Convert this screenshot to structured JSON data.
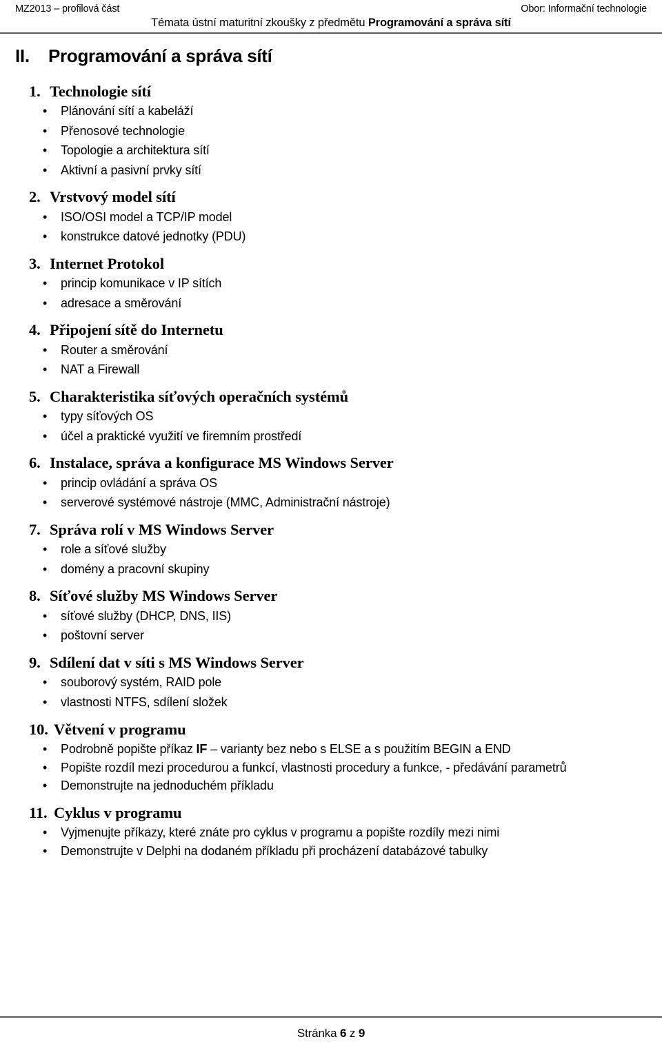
{
  "header": {
    "left": "MZ2013 – profilová část",
    "right": "Obor: Informační technologie",
    "subtitle_prefix": "Témata ústní maturitní zkoušky z předmětu ",
    "subtitle_strong": "Programování a správa sítí"
  },
  "section": {
    "number": "II.",
    "title": "Programování a správa sítí"
  },
  "topics": [
    {
      "number": "1.",
      "title": "Technologie sítí",
      "bullets": [
        "Plánování sítí a kabeláží",
        "Přenosové technologie",
        "Topologie a architektura sítí",
        "Aktivní a pasivní prvky sítí"
      ]
    },
    {
      "number": "2.",
      "title": "Vrstvový model sítí",
      "bullets": [
        "ISO/OSI model a TCP/IP model",
        "konstrukce datové jednotky (PDU)"
      ]
    },
    {
      "number": "3.",
      "title": "Internet Protokol",
      "bullets": [
        "princip komunikace v IP sítích",
        "adresace a směrování"
      ]
    },
    {
      "number": "4.",
      "title": "Připojení sítě do Internetu",
      "bullets": [
        "Router a směrování",
        "NAT a Firewall"
      ]
    },
    {
      "number": "5.",
      "title": "Charakteristika síťových operačních systémů",
      "bullets": [
        "typy síťových OS",
        "účel a praktické využití ve firemním prostředí"
      ]
    },
    {
      "number": "6.",
      "title": "Instalace, správa a konfigurace MS Windows Server",
      "bullets": [
        "princip ovládání a správa OS",
        "serverové systémové nástroje (MMC, Administrační nástroje)"
      ]
    },
    {
      "number": "7.",
      "title": "Správa rolí v MS Windows Server",
      "bullets": [
        "role a síťové služby",
        "domény a pracovní skupiny"
      ]
    },
    {
      "number": "8.",
      "title": "Síťové služby MS Windows Server",
      "bullets": [
        "síťové služby (DHCP, DNS, IIS)",
        "poštovní server"
      ]
    },
    {
      "number": "9.",
      "title": "Sdílení dat v síti s MS Windows Server",
      "bullets": [
        "souborový systém, RAID pole",
        "vlastnosti NTFS, sdílení složek"
      ]
    },
    {
      "number": "10.",
      "title": "Větvení v programu",
      "bullets_html": [
        "Podrobně popište příkaz <b>IF</b> – varianty bez nebo s ELSE a s použitím BEGIN a END",
        "Popište rozdíl mezi procedurou a funkcí, vlastnosti procedury a funkce, - předávání parametrů",
        "Demonstrujte na jednoduchém příkladu"
      ]
    },
    {
      "number": "11.",
      "title": "Cyklus v programu",
      "bullets": [
        "Vyjmenujte příkazy, které znáte pro cyklus v programu a popište rozdíly mezi nimi",
        "Demonstrujte v Delphi na dodaném příkladu při procházení databázové tabulky"
      ]
    }
  ],
  "footer": {
    "prefix": "Stránka ",
    "current_page": "6",
    "separator": " z ",
    "total_pages": "9"
  },
  "bullet_glyph": "•",
  "colors": {
    "text": "#000000",
    "rule": "#595959",
    "background": "#ffffff"
  }
}
